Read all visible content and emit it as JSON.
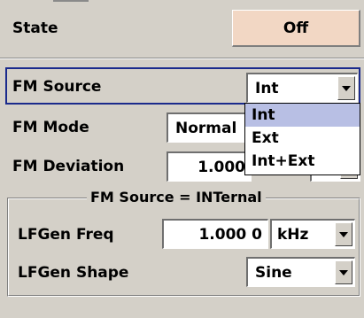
{
  "state": {
    "label": "State",
    "button": "Off"
  },
  "fm_source": {
    "label": "FM Source",
    "value": "Int",
    "options": [
      "Int",
      "Ext",
      "Int+Ext"
    ],
    "selected_index": 0
  },
  "fm_mode": {
    "label": "FM Mode",
    "value": "Normal"
  },
  "fm_deviation": {
    "label": "FM Deviation",
    "value": "1.000"
  },
  "group": {
    "title": "FM Source = INTernal",
    "lfgen_freq": {
      "label": "LFGen Freq",
      "value": "1.000 0",
      "unit": "kHz"
    },
    "lfgen_shape": {
      "label": "LFGen Shape",
      "value": "Sine"
    }
  },
  "colors": {
    "focus_border": "#1a2a8c",
    "selection_bg": "#b8bfe4",
    "off_button_bg": "#f2d7c4",
    "panel_bg": "#d4d0c8"
  }
}
